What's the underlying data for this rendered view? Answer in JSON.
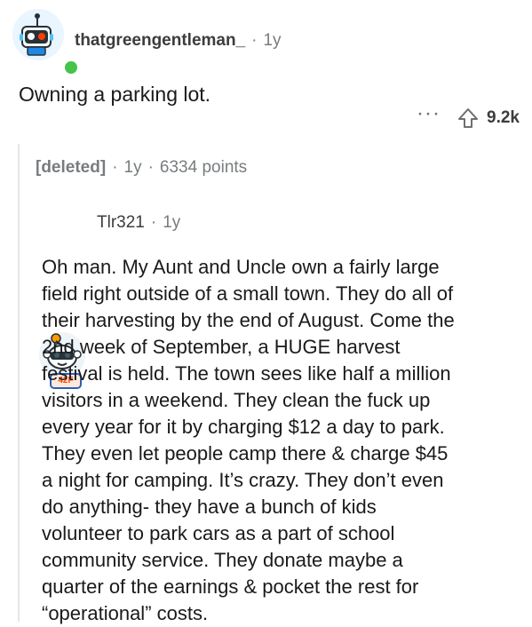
{
  "comment": {
    "username": "thatgreengentleman_",
    "separator": "·",
    "age": "1y",
    "body": "Owning a parking lot.",
    "actions": {
      "more_label": "···",
      "upvote_count": "9.2k"
    }
  },
  "reply": {
    "deleted_label": "[deleted]",
    "separator": "·",
    "age": "1y",
    "points": "6334 points",
    "nested": {
      "username": "Tlr321",
      "separator": "·",
      "age": "1y",
      "avatar_badge": "42F",
      "body_lines": [
        "Oh man. My Aunt and Uncle own a fairly large",
        "field right outside of a small town. They do all of",
        "their harvesting by the end of August. Come the",
        "2nd week of September, a HUGE harvest",
        "festival is held. The town sees like half a million",
        "visitors in a weekend. They clean the fuck up",
        "every year for it by charging $12 a day to park.",
        "They even let people camp there & charge $45",
        "a night for camping. It’s crazy. They don’t even",
        "do anything- they have a bunch of kids",
        "volunteer to park cars as a part of school",
        "community service. They donate maybe a",
        "quarter of the earnings & pocket the rest for",
        "“operational” costs."
      ]
    }
  },
  "colors": {
    "accent": "#ff4500",
    "secondary_text": "#787c7e",
    "online": "#46c34a"
  },
  "icons": {
    "avatar_top": "robot-avatar-icon",
    "avatar_reply": "snoo-avatar-icon",
    "more": "more-options-icon",
    "upvote": "upvote-icon"
  }
}
